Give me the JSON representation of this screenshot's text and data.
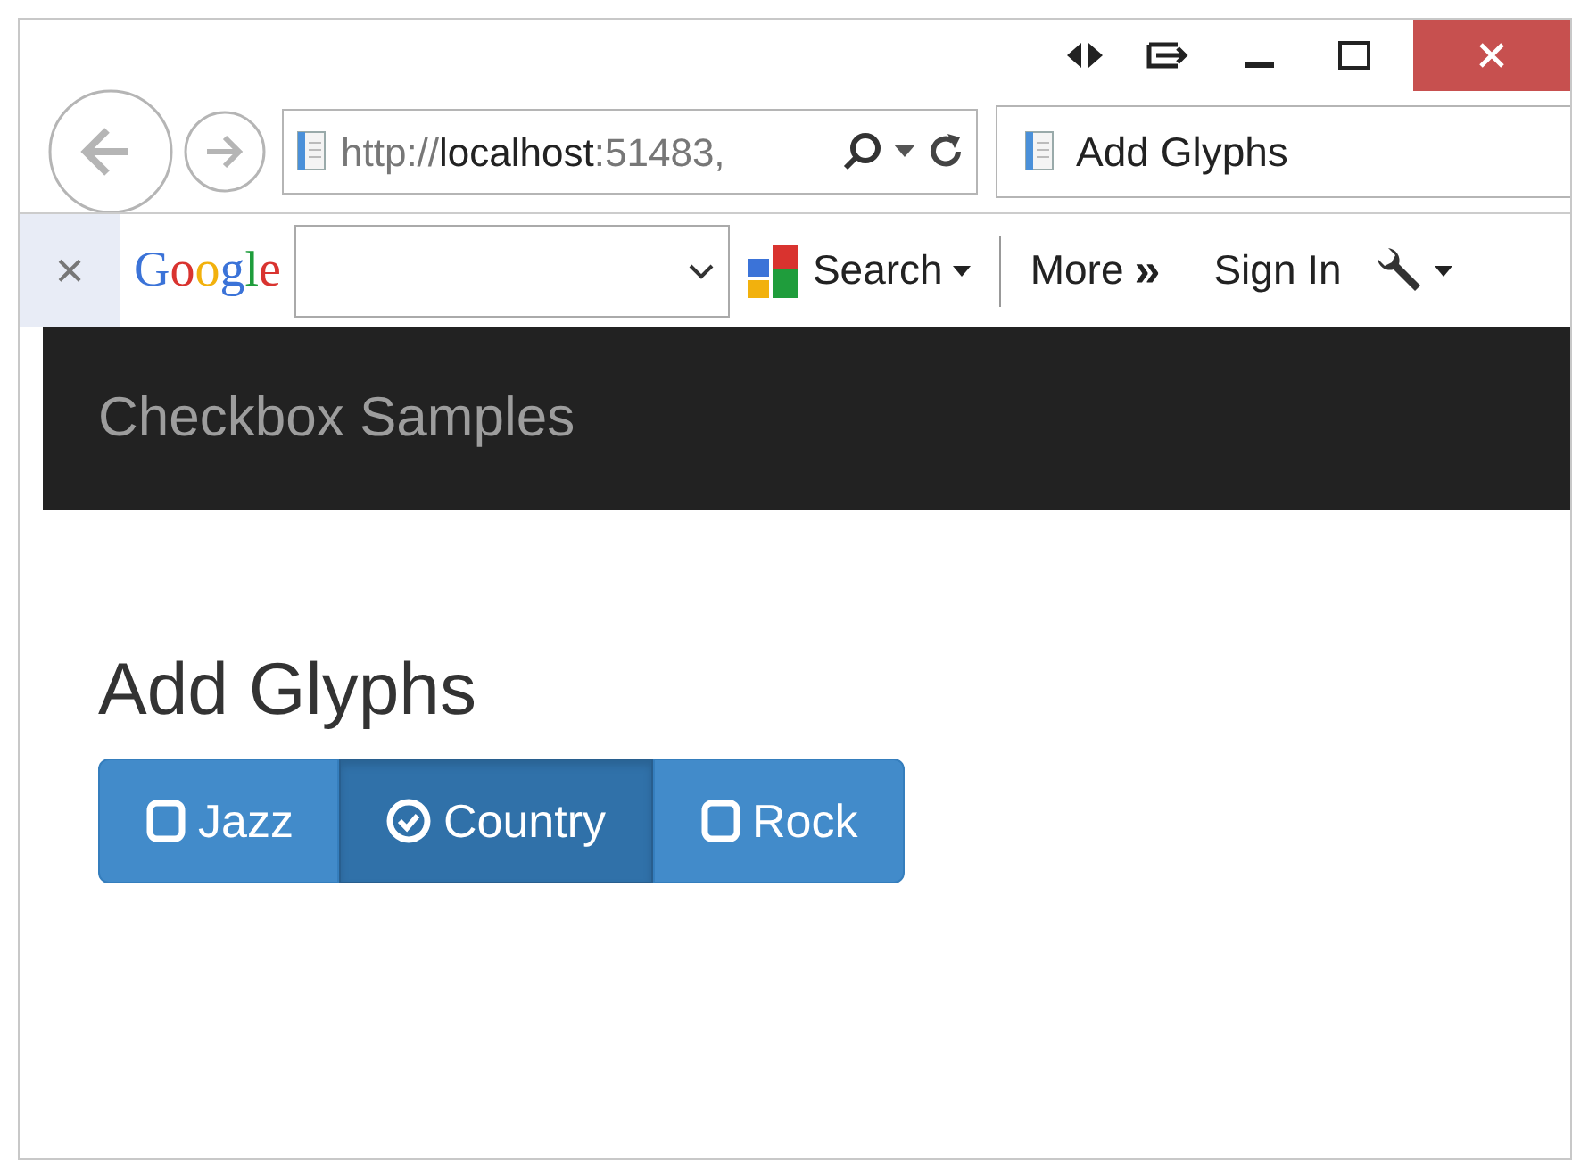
{
  "browser": {
    "address": "http://**localhost**:51483,",
    "tab_title": "Add Glyphs"
  },
  "toolbar": {
    "close": "×",
    "logo": "Google",
    "search_button": "Search",
    "more": "More",
    "more_glyph": "»",
    "sign_in": "Sign In"
  },
  "navbar": {
    "brand": "Checkbox Samples"
  },
  "page": {
    "heading": "Add Glyphs",
    "options": [
      {
        "label": "Jazz",
        "selected": false
      },
      {
        "label": "Country",
        "selected": true
      },
      {
        "label": "Rock",
        "selected": false
      }
    ]
  }
}
